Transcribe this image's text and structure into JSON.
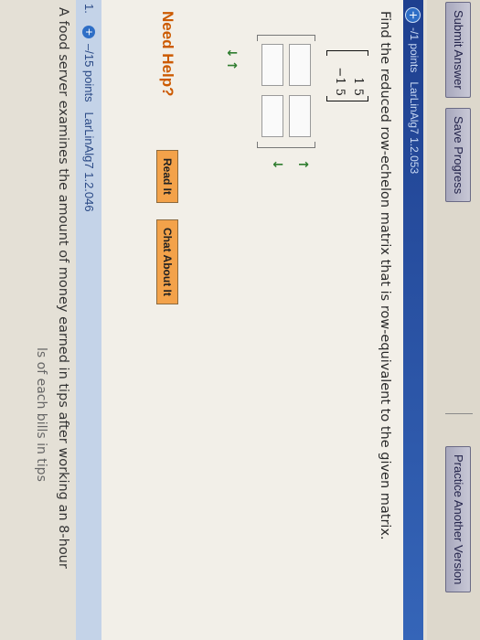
{
  "toolbar": {
    "submit_label": "Submit Answer",
    "save_label": "Save Progress",
    "practice_label": "Practice Another Version"
  },
  "question1": {
    "points_label": "-/1 points",
    "ref": "LarLinAlg7 1.2.053",
    "prompt": "Find the reduced row-echelon matrix that is row-equivalent to the given matrix.",
    "matrix": {
      "row1": "1  5",
      "row2": "−1  5"
    },
    "arrows_left": "↓↑",
    "arrows_right_top": "↑",
    "arrows_right_bottom": "↓"
  },
  "help": {
    "label": "Need Help?",
    "read_it": "Read It",
    "chat_about_it": "Chat About It"
  },
  "question2": {
    "number": "1.",
    "points_label": "–/15 points",
    "ref": "LarLinAlg7 1.2.046",
    "text": "A food server examines the amount of money earned in tips after working an 8-hour",
    "text2": "ls of each bills in tips"
  },
  "colors": {
    "header_blue": "#1e3f8f",
    "help_orange": "#cc5a00",
    "button_orange": "#f3a24a"
  }
}
